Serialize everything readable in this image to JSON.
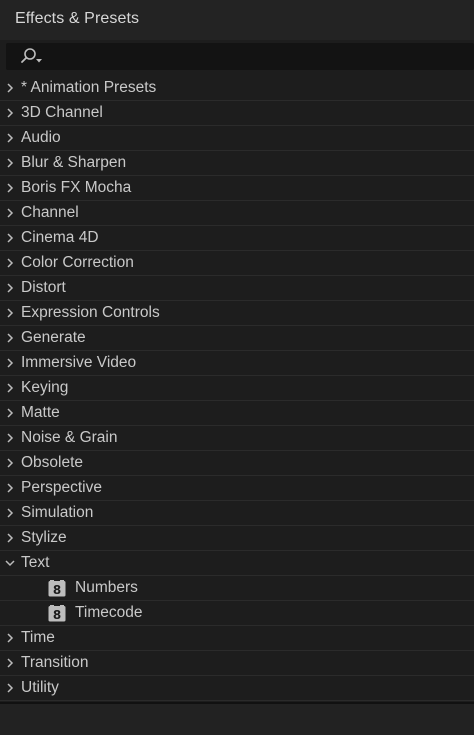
{
  "panel": {
    "title": "Effects & Presets"
  },
  "search": {
    "value": "",
    "placeholder": "",
    "icon": "search-icon"
  },
  "items": [
    {
      "label": "* Animation Presets",
      "expanded": false,
      "type": "category"
    },
    {
      "label": "3D Channel",
      "expanded": false,
      "type": "category"
    },
    {
      "label": "Audio",
      "expanded": false,
      "type": "category"
    },
    {
      "label": "Blur & Sharpen",
      "expanded": false,
      "type": "category"
    },
    {
      "label": "Boris FX Mocha",
      "expanded": false,
      "type": "category"
    },
    {
      "label": "Channel",
      "expanded": false,
      "type": "category"
    },
    {
      "label": "Cinema 4D",
      "expanded": false,
      "type": "category"
    },
    {
      "label": "Color Correction",
      "expanded": false,
      "type": "category"
    },
    {
      "label": "Distort",
      "expanded": false,
      "type": "category"
    },
    {
      "label": "Expression Controls",
      "expanded": false,
      "type": "category"
    },
    {
      "label": "Generate",
      "expanded": false,
      "type": "category"
    },
    {
      "label": "Immersive Video",
      "expanded": false,
      "type": "category"
    },
    {
      "label": "Keying",
      "expanded": false,
      "type": "category"
    },
    {
      "label": "Matte",
      "expanded": false,
      "type": "category"
    },
    {
      "label": "Noise & Grain",
      "expanded": false,
      "type": "category"
    },
    {
      "label": "Obsolete",
      "expanded": false,
      "type": "category"
    },
    {
      "label": "Perspective",
      "expanded": false,
      "type": "category"
    },
    {
      "label": "Simulation",
      "expanded": false,
      "type": "category"
    },
    {
      "label": "Stylize",
      "expanded": false,
      "type": "category"
    },
    {
      "label": "Text",
      "expanded": true,
      "type": "category"
    },
    {
      "label": "Numbers",
      "type": "effect",
      "badge": "8"
    },
    {
      "label": "Timecode",
      "type": "effect",
      "badge": "8"
    },
    {
      "label": "Time",
      "expanded": false,
      "type": "category"
    },
    {
      "label": "Transition",
      "expanded": false,
      "type": "category"
    },
    {
      "label": "Utility",
      "expanded": false,
      "type": "category"
    }
  ],
  "colors": {
    "background": "#1d1d1d",
    "text": "#c9c9c9",
    "separator": "#2b2b2b",
    "search_bg": "#131313"
  }
}
